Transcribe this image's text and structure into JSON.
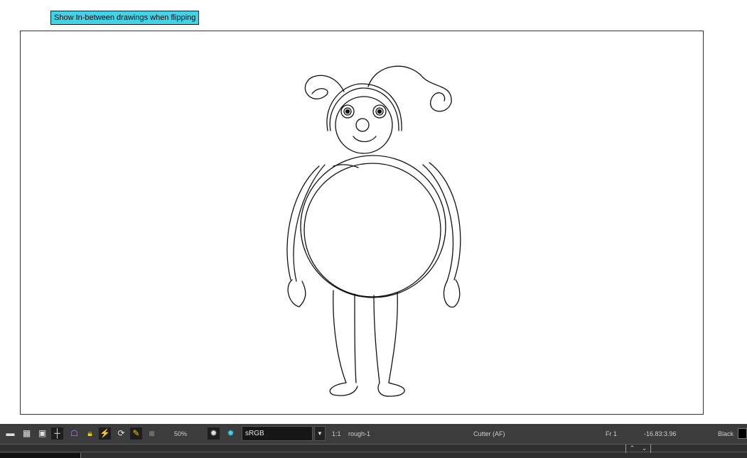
{
  "tooltip": {
    "text": "Show In-between drawings when flipping"
  },
  "toolbar": {
    "icons": [
      "single-view-icon",
      "grid-view-icon",
      "safe-area-icon",
      "onion-skin-icon",
      "light-table-icon",
      "lock-icon",
      "quick-flip-icon",
      "rotate-view-icon",
      "paint-icon",
      "camera-icon",
      "settings-gear-icon",
      "color-gear-icon"
    ],
    "zoom": "50%",
    "color_profile": {
      "selected": "sRGB"
    },
    "ratio": "1:1",
    "drawing_name": "rough-1",
    "tool": "Cutter (AF)",
    "frame": "Fr 1",
    "coordinates": "-16.83:3.96",
    "color_name": "Black",
    "colors": {
      "swatch": "#000000",
      "accent": "#43d3e8",
      "active_icon": "#f0d000"
    }
  }
}
